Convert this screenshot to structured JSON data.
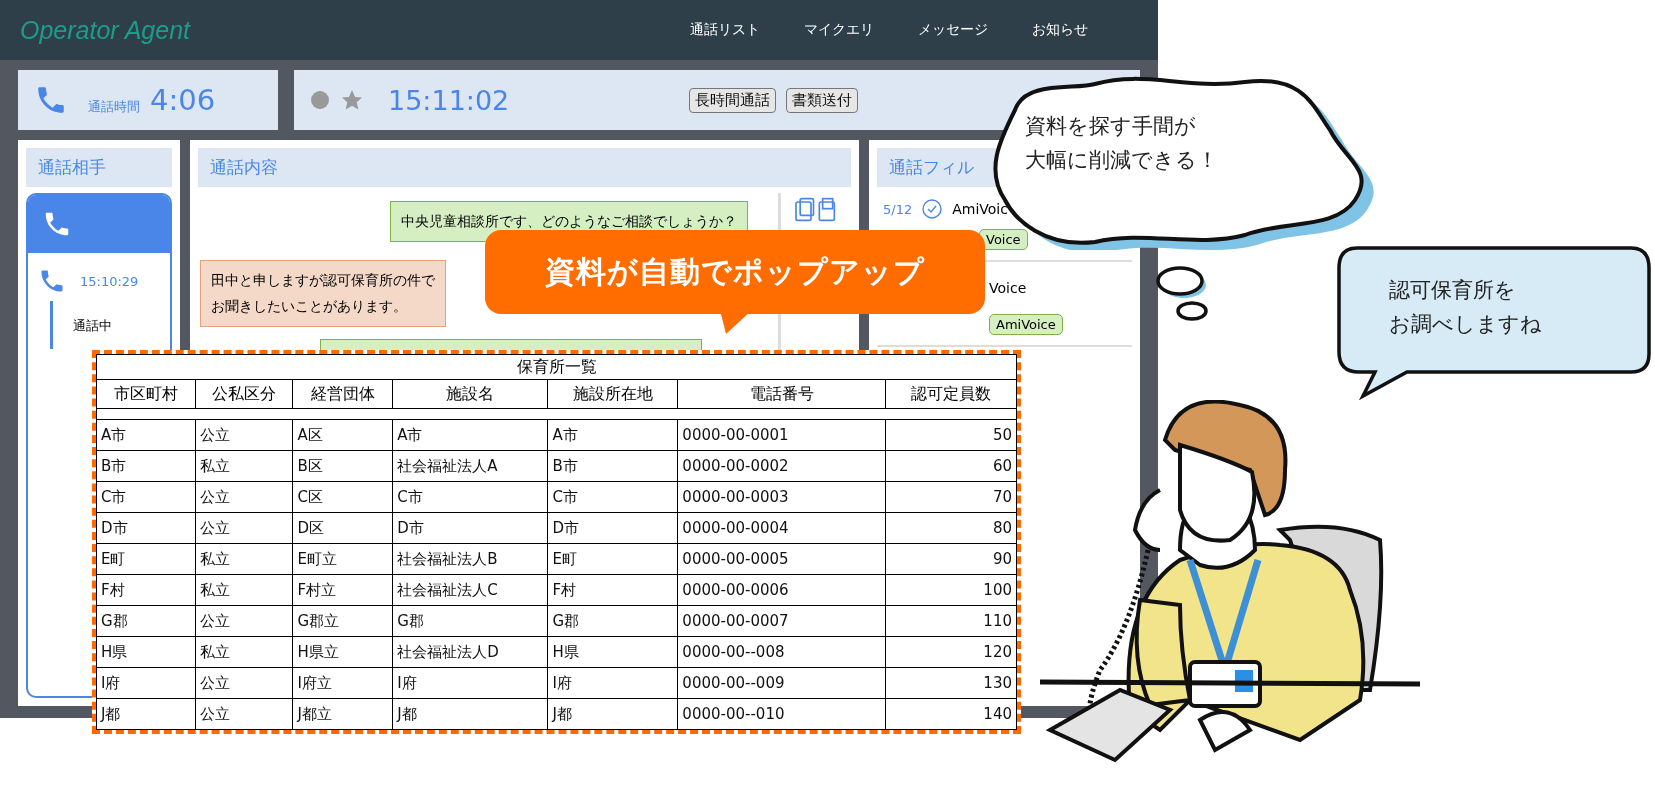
{
  "app": {
    "title": "Operator Agent",
    "nav": [
      "通話リスト",
      "マイクエリ",
      "メッセージ",
      "お知らせ"
    ]
  },
  "call_timer": {
    "label": "通話時間",
    "time": "4:06"
  },
  "status_bar": {
    "time": "15:11:02",
    "tags": [
      "長時間通話",
      "書類送付"
    ]
  },
  "contact_panel": {
    "title": "通話相手",
    "entry": {
      "time": "15:10:29",
      "status": "通話中"
    }
  },
  "transcript_panel": {
    "title": "通話内容",
    "messages": [
      {
        "kind": "operator",
        "lines": [
          "中央児童相談所です、どのようなご相談でしょうか？"
        ]
      },
      {
        "kind": "caller",
        "lines": [
          "田中と申しますが認可保育所の件で",
          "お聞きしたいことがあります。"
        ]
      }
    ]
  },
  "filter_panel": {
    "title": "通話フィル",
    "items": [
      {
        "date": "5/12",
        "name": "AmiVoic",
        "tag": "Voice"
      },
      {
        "name": "Voice",
        "tag": "AmiVoice"
      }
    ]
  },
  "popup": {
    "callout": "資料が自動でポップアップ",
    "table": {
      "title": "保育所一覧",
      "columns": [
        "市区町村",
        "公私区分",
        "経営団体",
        "施設名",
        "施設所在地",
        "電話番号",
        "認可定員数"
      ],
      "rows": [
        [
          "A市",
          "公立",
          "A区",
          "A市",
          "A市",
          "0000-00-0001",
          "50"
        ],
        [
          "B市",
          "私立",
          "B区",
          "社会福祉法人A",
          "B市",
          "0000-00-0002",
          "60"
        ],
        [
          "C市",
          "公立",
          "C区",
          "C市",
          "C市",
          "0000-00-0003",
          "70"
        ],
        [
          "D市",
          "公立",
          "D区",
          "D市",
          "D市",
          "0000-00-0004",
          "80"
        ],
        [
          "E町",
          "私立",
          "E町立",
          "社会福祉法人B",
          "E町",
          "0000-00-0005",
          "90"
        ],
        [
          "F村",
          "私立",
          "F村立",
          "社会福祉法人C",
          "F村",
          "0000-00-0006",
          "100"
        ],
        [
          "G郡",
          "公立",
          "G郡立",
          "G郡",
          "G郡",
          "0000-00-0007",
          "110"
        ],
        [
          "H県",
          "私立",
          "H県立",
          "社会福祉法人D",
          "H県",
          "0000-00--008",
          "120"
        ],
        [
          "I府",
          "公立",
          "I府立",
          "I府",
          "I府",
          "0000-00--009",
          "130"
        ],
        [
          "J都",
          "公立",
          "J都立",
          "J都",
          "J都",
          "0000-00--010",
          "140"
        ]
      ]
    }
  },
  "thought_bubble": {
    "lines": [
      "資料を探す手間が",
      "大幅に削減できる！"
    ]
  },
  "speech_bubble": {
    "lines": [
      "認可保育所を",
      "お調べしますね"
    ]
  }
}
